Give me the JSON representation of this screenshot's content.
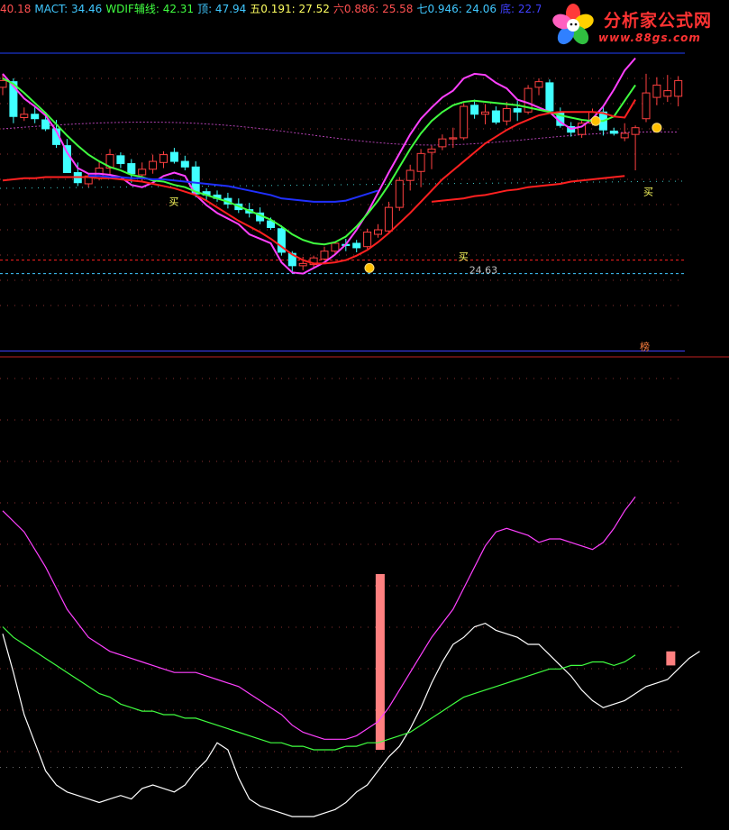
{
  "header": [
    {
      "text": "40.18",
      "color": "#ff5050"
    },
    {
      "text": "MACT: 34.46",
      "color": "#40c8ff"
    },
    {
      "text": "WDIF辅线: 42.31",
      "color": "#40ff40"
    },
    {
      "text": "顶: 47.94",
      "color": "#40c8ff"
    },
    {
      "text": "五0.191: 27.52",
      "color": "#ffff60"
    },
    {
      "text": "六0.886: 25.58",
      "color": "#ff5050"
    },
    {
      "text": "七0.946: 24.06",
      "color": "#40c8ff"
    },
    {
      "text": "底: 22.70",
      "color": "#4040ff"
    }
  ],
  "logo": {
    "title": "分析家公式网",
    "url": "www.88gs.com"
  },
  "chart_data": [
    {
      "type": "candlestick",
      "title": "",
      "ylim": [
        22.5,
        49
      ],
      "x": [
        0,
        1,
        2,
        3,
        4,
        5,
        6,
        7,
        8,
        9,
        10,
        11,
        12,
        13,
        14,
        15,
        16,
        17,
        18,
        19,
        20,
        21,
        22,
        23,
        24,
        25,
        26,
        27,
        28,
        29,
        30,
        31,
        32,
        33,
        34,
        35,
        36,
        37,
        38,
        39,
        40,
        41,
        42,
        43,
        44,
        45,
        46,
        47,
        48,
        49,
        50,
        51,
        52,
        53,
        54,
        55,
        56,
        57,
        58,
        59,
        60,
        61,
        62,
        63
      ],
      "ohlc": [
        [
          46.2,
          47.4,
          45.5,
          46.8
        ],
        [
          46.7,
          47.0,
          43.0,
          43.6
        ],
        [
          43.5,
          44.4,
          43.2,
          43.8
        ],
        [
          43.8,
          44.5,
          43.0,
          43.4
        ],
        [
          43.3,
          44.0,
          42.3,
          42.5
        ],
        [
          42.5,
          43.3,
          40.8,
          41.1
        ],
        [
          41.0,
          41.6,
          38.6,
          38.6
        ],
        [
          38.6,
          39.5,
          37.4,
          37.7
        ],
        [
          37.6,
          38.5,
          37.3,
          38.3
        ],
        [
          38.1,
          39.6,
          37.9,
          39.0
        ],
        [
          39.0,
          40.7,
          38.4,
          40.2
        ],
        [
          40.1,
          40.4,
          39.0,
          39.4
        ],
        [
          39.4,
          39.8,
          37.7,
          38.5
        ],
        [
          38.4,
          39.5,
          37.8,
          38.9
        ],
        [
          38.9,
          40.2,
          38.5,
          39.6
        ],
        [
          39.5,
          40.5,
          39.0,
          40.2
        ],
        [
          40.4,
          40.8,
          39.4,
          39.6
        ],
        [
          39.6,
          40.1,
          38.8,
          39.1
        ],
        [
          39.1,
          39.6,
          36.4,
          36.7
        ],
        [
          36.9,
          37.2,
          36.1,
          36.6
        ],
        [
          36.6,
          37.0,
          36.0,
          36.3
        ],
        [
          36.3,
          36.8,
          35.4,
          35.8
        ],
        [
          35.8,
          36.3,
          35.0,
          35.3
        ],
        [
          35.3,
          35.9,
          34.6,
          35.0
        ],
        [
          35.0,
          35.5,
          34.0,
          34.3
        ],
        [
          34.3,
          34.6,
          33.5,
          33.7
        ],
        [
          33.6,
          33.9,
          31.2,
          31.5
        ],
        [
          31.4,
          31.6,
          29.6,
          30.3
        ],
        [
          30.3,
          31.1,
          29.9,
          30.5
        ],
        [
          30.4,
          31.2,
          30.1,
          31.0
        ],
        [
          30.9,
          32.0,
          30.8,
          31.6
        ],
        [
          31.6,
          32.4,
          31.3,
          32.3
        ],
        [
          32.2,
          32.7,
          31.6,
          32.1
        ],
        [
          32.3,
          32.6,
          31.5,
          31.9
        ],
        [
          32.0,
          33.6,
          31.8,
          33.3
        ],
        [
          33.1,
          34.0,
          32.8,
          33.5
        ],
        [
          33.4,
          36.0,
          33.2,
          35.5
        ],
        [
          35.5,
          38.2,
          35.2,
          37.9
        ],
        [
          37.9,
          39.3,
          37.0,
          38.8
        ],
        [
          38.7,
          40.7,
          37.3,
          40.3
        ],
        [
          40.4,
          41.0,
          38.9,
          40.7
        ],
        [
          40.9,
          42.0,
          40.6,
          41.6
        ],
        [
          41.6,
          42.6,
          40.8,
          41.7
        ],
        [
          41.7,
          44.8,
          41.5,
          44.5
        ],
        [
          44.6,
          45.1,
          43.4,
          43.8
        ],
        [
          43.8,
          44.7,
          42.9,
          44.0
        ],
        [
          44.1,
          44.5,
          42.9,
          43.1
        ],
        [
          43.2,
          44.9,
          42.8,
          44.3
        ],
        [
          44.3,
          45.0,
          43.2,
          44.0
        ],
        [
          44.0,
          46.4,
          43.8,
          46.1
        ],
        [
          46.2,
          47.0,
          45.5,
          46.7
        ],
        [
          46.6,
          46.9,
          43.9,
          44.1
        ],
        [
          44.0,
          44.4,
          42.6,
          42.8
        ],
        [
          42.7,
          43.1,
          41.8,
          42.2
        ],
        [
          42.0,
          43.3,
          41.7,
          43.0
        ],
        [
          43.0,
          44.3,
          42.8,
          44.0
        ],
        [
          44.0,
          44.5,
          41.9,
          42.4
        ],
        [
          42.3,
          42.6,
          41.9,
          42.1
        ],
        [
          41.7,
          43.0,
          41.4,
          42.1
        ],
        [
          42.0,
          42.8,
          38.8,
          42.6
        ],
        [
          43.4,
          47.4,
          43.1,
          45.7
        ],
        [
          45.3,
          47.1,
          44.6,
          46.4
        ],
        [
          45.4,
          47.3,
          44.9,
          45.9
        ],
        [
          45.4,
          47.2,
          44.5,
          46.8
        ]
      ],
      "series": [
        {
          "color": "#ff40ff",
          "values": [
            47.4,
            46.3,
            45.2,
            44.5,
            43.7,
            42.3,
            40.4,
            39.0,
            38.5,
            38.5,
            38.4,
            38.2,
            37.5,
            37.3,
            37.7,
            38.3,
            38.6,
            38.3,
            36.6,
            35.7,
            35.0,
            34.5,
            34.0,
            33.1,
            32.7,
            32.3,
            30.6,
            29.7,
            29.6,
            30.1,
            30.6,
            31.3,
            32.2,
            33.5,
            35.0,
            36.8,
            38.6,
            40.3,
            42.0,
            43.4,
            44.4,
            45.3,
            45.9,
            47.0,
            47.4,
            47.3,
            46.6,
            46.1,
            45.1,
            44.8,
            44.4,
            44.0,
            43.1,
            42.5,
            42.7,
            43.4,
            44.5,
            46.0,
            47.7,
            48.8
          ]
        },
        {
          "color": "#40ff40",
          "values": [
            47.0,
            46.5,
            45.7,
            44.8,
            43.9,
            42.9,
            41.9,
            41.0,
            40.2,
            39.6,
            39.1,
            38.8,
            38.4,
            38.2,
            37.9,
            37.8,
            37.5,
            37.3,
            36.9,
            36.6,
            36.3,
            36.0,
            35.6,
            35.2,
            34.8,
            34.4,
            33.8,
            33.1,
            32.6,
            32.3,
            32.2,
            32.4,
            32.9,
            33.8,
            34.9,
            36.1,
            37.5,
            39.1,
            40.7,
            42.1,
            43.2,
            44.0,
            44.6,
            44.9,
            45.0,
            44.9,
            44.8,
            44.7,
            44.6,
            44.4,
            44.2,
            44.0,
            43.7,
            43.5,
            43.3,
            43.2,
            43.2,
            43.6,
            45.0,
            46.4
          ]
        },
        {
          "color": "#ff2020",
          "values": [
            37.9,
            38.0,
            38.1,
            38.1,
            38.2,
            38.2,
            38.2,
            38.2,
            38.2,
            38.1,
            38.1,
            38.0,
            37.9,
            37.8,
            37.6,
            37.4,
            37.2,
            36.9,
            36.6,
            36.1,
            35.5,
            34.9,
            34.3,
            33.8,
            33.3,
            32.7,
            32.0,
            31.3,
            30.8,
            30.5,
            30.5,
            30.6,
            30.8,
            31.2,
            31.7,
            32.4,
            33.2,
            34.1,
            35.0,
            36.0,
            37.0,
            38.0,
            38.8,
            39.6,
            40.4,
            41.2,
            41.8,
            42.4,
            42.9,
            43.3,
            43.7,
            43.9,
            44.0,
            44.0,
            44.0,
            44.0,
            43.9,
            43.6,
            43.5,
            45.1
          ]
        },
        {
          "color": "#2030ff",
          "values": [
            38.3,
            38.3,
            38.2,
            38.2,
            38.1,
            38.1,
            38.0,
            38.0,
            37.9,
            37.8,
            37.7,
            37.6,
            37.5,
            37.4,
            37.2,
            37.0,
            36.8,
            36.6,
            36.3,
            36.2,
            36.1,
            36.0,
            36.0,
            36.0,
            36.1,
            36.4,
            36.7,
            37.0
          ]
        },
        {
          "color": "#ff2020",
          "values": [
            36.0,
            36.1,
            36.2,
            36.3,
            36.5,
            36.6,
            36.8,
            37.0,
            37.1,
            37.3,
            37.4,
            37.5,
            37.6,
            37.8,
            37.9,
            38.0,
            38.1,
            38.2,
            38.3
          ]
        }
      ],
      "annotations": [
        {
          "text": "买",
          "x": 16,
          "y": 35.7,
          "color": "#ffff60"
        },
        {
          "text": "买",
          "x": 43,
          "y": 30.8,
          "color": "#ffff60"
        },
        {
          "text": "买",
          "x": 90,
          "y": 36.6,
          "color": "#ffff60"
        },
        {
          "text": "24.63",
          "x": 43,
          "y": 29.6,
          "color": "#c0c0c0"
        },
        {
          "text": "榜",
          "x": 89,
          "y": 22.8,
          "color": "#ff8040"
        }
      ],
      "levels": [
        {
          "y": 30.8,
          "color": "#ff2020"
        },
        {
          "y": 29.6,
          "color": "#40c8ff"
        },
        {
          "y": 22.7,
          "color": "#4040ff"
        }
      ]
    },
    {
      "type": "line",
      "title": "",
      "ylim": [
        0,
        100
      ],
      "series": [
        {
          "color": "#ffffff",
          "values": [
            53,
            42,
            30,
            22,
            14,
            10,
            8,
            7,
            6,
            5,
            6,
            7,
            6,
            9,
            10,
            9,
            8,
            10,
            14,
            17,
            22,
            20,
            12,
            6,
            4,
            3,
            2,
            1,
            1,
            1,
            2,
            3,
            5,
            8,
            10,
            14,
            18,
            21,
            26,
            32,
            39,
            45,
            50,
            52,
            55,
            56,
            54,
            53,
            52,
            50,
            50,
            47,
            44,
            41,
            37,
            34,
            32,
            33,
            34,
            36,
            38,
            39,
            40,
            43,
            46,
            48
          ]
        },
        {
          "color": "#ff40ff",
          "values": [
            88,
            85,
            82,
            77,
            72,
            66,
            60,
            56,
            52,
            50,
            48,
            47,
            46,
            45,
            44,
            43,
            42,
            42,
            42,
            41,
            40,
            39,
            38,
            36,
            34,
            32,
            30,
            27,
            25,
            24,
            23,
            23,
            23,
            24,
            26,
            28,
            32,
            37,
            42,
            47,
            52,
            56,
            60,
            66,
            72,
            78,
            82,
            83,
            82,
            81,
            79,
            80,
            80,
            79,
            78,
            77,
            79,
            83,
            88,
            92
          ]
        },
        {
          "color": "#40ff40",
          "values": [
            55,
            52,
            50,
            48,
            46,
            44,
            42,
            40,
            38,
            36,
            35,
            33,
            32,
            31,
            31,
            30,
            30,
            29,
            29,
            28,
            27,
            26,
            25,
            24,
            23,
            22,
            22,
            21,
            21,
            20,
            20,
            20,
            21,
            21,
            22,
            22,
            23,
            24,
            25,
            27,
            29,
            31,
            33,
            35,
            36,
            37,
            38,
            39,
            40,
            41,
            42,
            43,
            43,
            44,
            44,
            45,
            45,
            44,
            45,
            47
          ]
        }
      ],
      "bars": [
        {
          "x": 35.2,
          "low": 20,
          "high": 70,
          "color": "#ff8080"
        },
        {
          "x": 62.3,
          "low": 44,
          "high": 48,
          "color": "#ff8080"
        }
      ],
      "levels": [
        {
          "y": 15,
          "color": "#6a6a6a"
        }
      ]
    }
  ]
}
